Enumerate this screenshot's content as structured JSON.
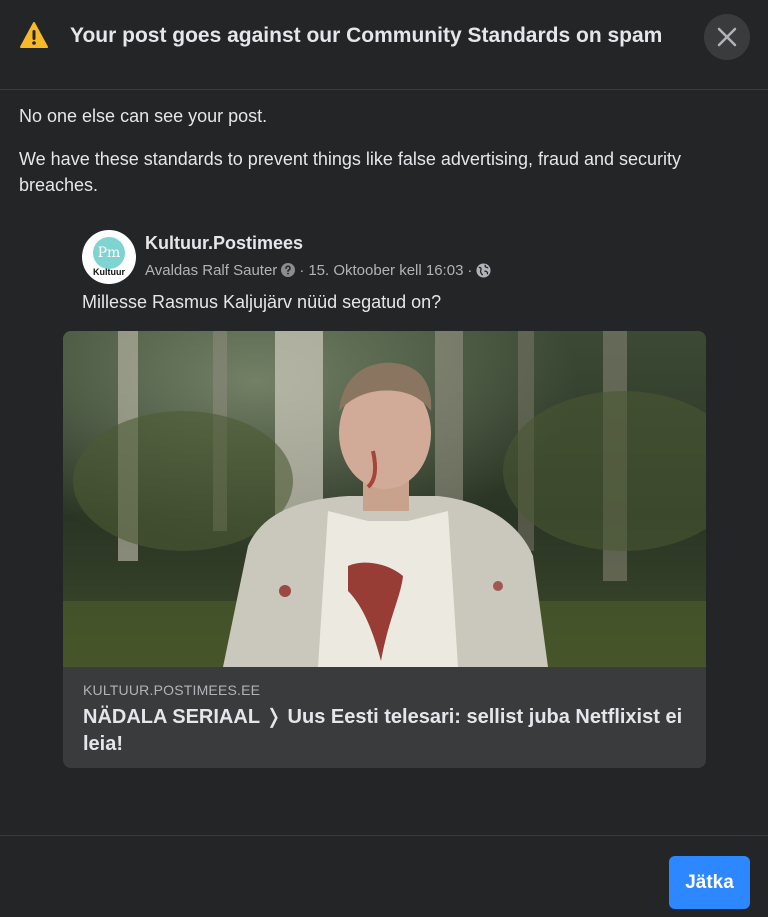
{
  "dialog": {
    "title": "Your post goes against our Community Standards on spam",
    "message_1": "No one else can see your post.",
    "message_2": "We have these standards to prevent things like false advertising, fraud and security breaches.",
    "icons": {
      "warning": "warning-triangle-icon",
      "close": "close-x-icon"
    }
  },
  "post": {
    "page_name": "Kultuur.Postimees",
    "avatar": {
      "monogram": "Pm",
      "word": "Kultuur",
      "color": "#7fd3d0"
    },
    "author": "Avaldas Ralf Sauter",
    "separator": "·",
    "date": "15. Oktoober kell 16:03",
    "text": "Millesse Rasmus Kaljujärv nüüd segatud on?",
    "icons": {
      "help": "question-circle-icon",
      "audience": "globe-icon"
    },
    "link": {
      "domain": "KULTUUR.POSTIMEES.EE",
      "title": "NÄDALA SERIAAL ❭ Uus Eesti telesari: sellist juba Netflixist ei leia!"
    }
  },
  "footer": {
    "continue_label": "Jätka"
  },
  "colors": {
    "background": "#242526",
    "accent": "#2d88ff",
    "warning": "#f7b928"
  }
}
